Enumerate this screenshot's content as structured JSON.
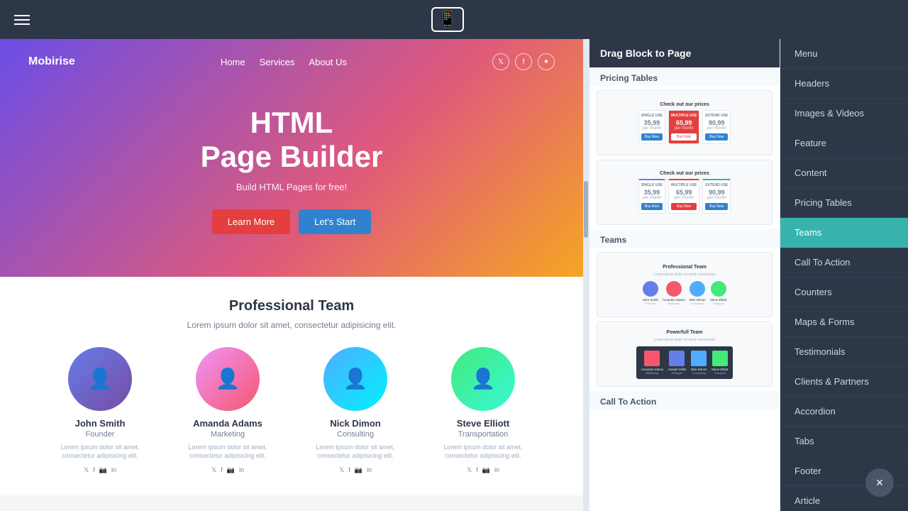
{
  "topbar": {
    "title": "Drag Block to Page"
  },
  "preview": {
    "logo": "Mobirise",
    "nav_links": [
      "Home",
      "Services",
      "About Us"
    ],
    "hero_title_line1": "HTML",
    "hero_title_line2": "Page Builder",
    "hero_subtitle": "Build HTML Pages for free!",
    "btn_learn": "Learn More",
    "btn_start": "Let's Start",
    "team_section_title": "Professional Team",
    "team_section_desc": "Lorem ipsum dolor sit amet, consectetur adipisicing elit.",
    "members": [
      {
        "name": "John Smith",
        "role": "Founder",
        "desc": "Lorem ipsum dolor sit amet, consectetur adipisicing elit."
      },
      {
        "name": "Amanda Adams",
        "role": "Marketing",
        "desc": "Lorem ipsum dolor sit amet, consectetur adipisicing elit."
      },
      {
        "name": "Nick Dimon",
        "role": "Consulting",
        "desc": "Lorem ipsum dolor sit amet, consectetur adipisicing elit."
      },
      {
        "name": "Steve Elliott",
        "role": "Transportation",
        "desc": "Lorem ipsum dolor sit amet, consectetur adipisicing elit."
      }
    ]
  },
  "blocks_panel": {
    "header": "Drag Block to Page",
    "sections": [
      {
        "label": "Pricing Tables",
        "thumbs": [
          {
            "type": "pricing",
            "title": "Check out our prices",
            "plans": [
              {
                "name": "SINGLE USE",
                "price": "35,99",
                "featured": false
              },
              {
                "name": "MULTIPLE USE",
                "price": "65,99",
                "featured": true
              },
              {
                "name": "EXTEND USE",
                "price": "90,99",
                "featured": false
              }
            ]
          },
          {
            "type": "pricing2",
            "title": "Check out our prices",
            "plans": [
              {
                "name": "SINGLE USE",
                "price": "35,99",
                "featured": false
              },
              {
                "name": "MULTIPLE USE",
                "price": "65,99",
                "featured": true
              },
              {
                "name": "EXTEND USE",
                "price": "90,99",
                "featured": false
              }
            ]
          }
        ]
      },
      {
        "label": "Teams",
        "thumbs": [
          {
            "type": "team",
            "title": "Professional Team",
            "members": [
              {
                "color": "#667eea",
                "name": "John Smith",
                "role": "Founder"
              },
              {
                "color": "#f5576c",
                "name": "Amanda Adams",
                "role": "Marketing"
              },
              {
                "color": "#4facfe",
                "name": "Nick Dimon",
                "role": "Consulting"
              },
              {
                "color": "#43e97b",
                "name": "Steve Elliott",
                "role": "Transport"
              }
            ]
          },
          {
            "type": "team2",
            "title": "Powerfull Team",
            "members": [
              {
                "color": "#f5576c",
                "name": "Amanda Adams",
                "role": "Marketing"
              },
              {
                "color": "#667eea",
                "name": "Joseph Miller",
                "role": "Designer"
              },
              {
                "color": "#4facfe",
                "name": "Nick Dimon",
                "role": "Consulting"
              },
              {
                "color": "#43e97b",
                "name": "Steve Elliott",
                "role": "Transport"
              }
            ]
          }
        ]
      }
    ]
  },
  "right_nav": {
    "items": [
      {
        "label": "Menu",
        "active": false
      },
      {
        "label": "Headers",
        "active": false
      },
      {
        "label": "Images & Videos",
        "active": false
      },
      {
        "label": "Feature",
        "active": false
      },
      {
        "label": "Content",
        "active": false
      },
      {
        "label": "Pricing Tables",
        "active": false
      },
      {
        "label": "Teams",
        "active": true
      },
      {
        "label": "Call To Action",
        "active": false
      },
      {
        "label": "Counters",
        "active": false
      },
      {
        "label": "Maps & Forms",
        "active": false
      },
      {
        "label": "Testimonials",
        "active": false
      },
      {
        "label": "Clients & Partners",
        "active": false
      },
      {
        "label": "Accordion",
        "active": false
      },
      {
        "label": "Tabs",
        "active": false
      },
      {
        "label": "Footer",
        "active": false
      },
      {
        "label": "Article",
        "active": false
      }
    ]
  },
  "close_button_label": "×"
}
